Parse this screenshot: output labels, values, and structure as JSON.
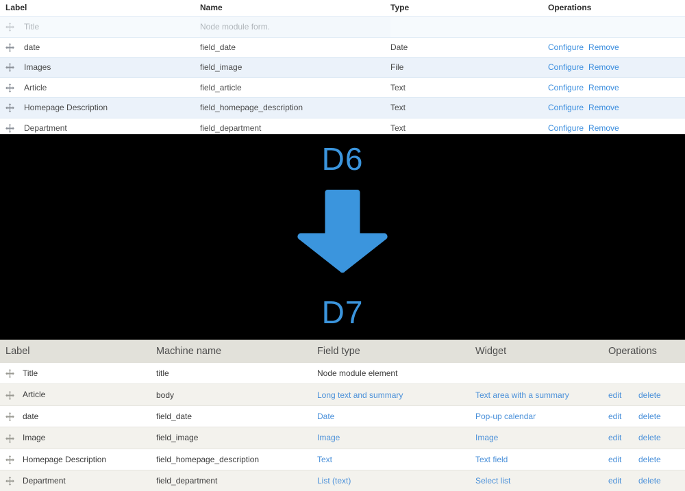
{
  "d6_table": {
    "headers": [
      "Label",
      "Name",
      "Type",
      "Operations"
    ],
    "ops_labels": {
      "configure": "Configure",
      "remove": "Remove"
    },
    "rows": [
      {
        "label": "Title",
        "name": "Node module form.",
        "type": "",
        "has_ops": false,
        "placeholder": true
      },
      {
        "label": "date",
        "name": "field_date",
        "type": "Date",
        "has_ops": true,
        "placeholder": false
      },
      {
        "label": "Images",
        "name": "field_image",
        "type": "File",
        "has_ops": true,
        "placeholder": false
      },
      {
        "label": "Article",
        "name": "field_article",
        "type": "Text",
        "has_ops": true,
        "placeholder": false
      },
      {
        "label": "Homepage Description",
        "name": "field_homepage_description",
        "type": "Text",
        "has_ops": true,
        "placeholder": false
      },
      {
        "label": "Department",
        "name": "field_department",
        "type": "Text",
        "has_ops": true,
        "placeholder": false
      }
    ]
  },
  "banner": {
    "top_label": "D6",
    "bottom_label": "D7",
    "arrow_icon": "arrow-down-icon",
    "background_color": "#000000",
    "accent_color": "#3b95dd"
  },
  "d7_table": {
    "headers": [
      "Label",
      "Machine name",
      "Field type",
      "Widget",
      "Operations"
    ],
    "ops_labels": {
      "edit": "edit",
      "delete": "delete"
    },
    "rows": [
      {
        "label": "Title",
        "machine_name": "title",
        "field_type": "Node module element",
        "field_type_link": false,
        "widget": "",
        "has_ops": false
      },
      {
        "label": "Article",
        "machine_name": "body",
        "field_type": "Long text and summary",
        "field_type_link": true,
        "widget": "Text area with a summary",
        "has_ops": true
      },
      {
        "label": "date",
        "machine_name": "field_date",
        "field_type": "Date",
        "field_type_link": true,
        "widget": "Pop-up calendar",
        "has_ops": true
      },
      {
        "label": "Image",
        "machine_name": "field_image",
        "field_type": "Image",
        "field_type_link": true,
        "widget": "Image",
        "has_ops": true
      },
      {
        "label": "Homepage Description",
        "machine_name": "field_homepage_description",
        "field_type": "Text",
        "field_type_link": true,
        "widget": "Text field",
        "has_ops": true
      },
      {
        "label": "Department",
        "machine_name": "field_department",
        "field_type": "List (text)",
        "field_type_link": true,
        "widget": "Select list",
        "has_ops": true
      }
    ]
  },
  "colors": {
    "link_blue_d6": "#3a8dde",
    "link_blue_d7": "#4a90d9",
    "row_alt_d6": "#ebf2fa",
    "row_alt_d7": "#f3f2ed",
    "header_bg_d7": "#e2e1da"
  }
}
